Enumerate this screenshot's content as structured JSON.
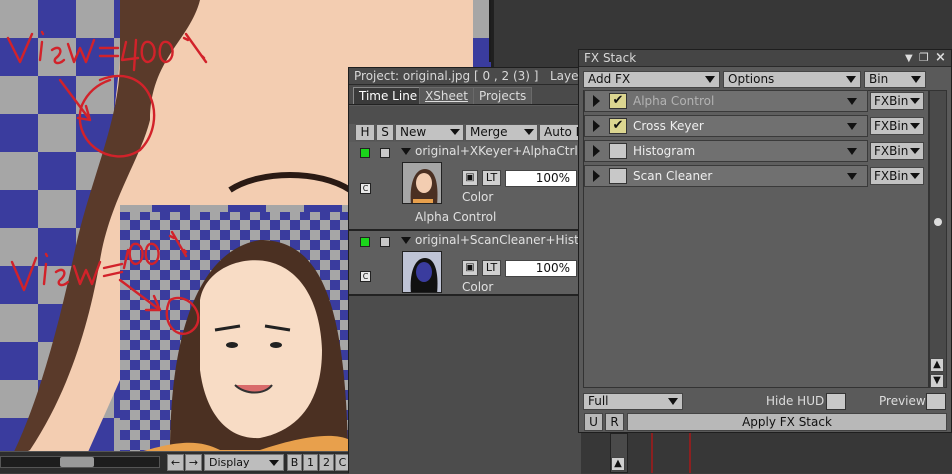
{
  "viewer": {
    "annotation_large": "view=400%",
    "annotation_small": "view=100%",
    "toolbar": {
      "display_label": "Display",
      "b_label": "B",
      "one_label": "1",
      "two_label": "2",
      "c_label": "C"
    }
  },
  "timeline": {
    "title": "Project: original.jpg [ 0 , 2  (3) ]",
    "title_suffix": "Layer:",
    "tabs": [
      "Time Line",
      "XSheet",
      "Projects"
    ],
    "columns": {
      "h": "H",
      "s": "S",
      "new": "New",
      "merge": "Merge",
      "auto": "Auto F"
    },
    "layers": [
      {
        "name": "original+XKeyer+AlphaCtrl",
        "opacity": "100%",
        "lock_label": "ὑ2",
        "lt_label": "LT",
        "mode": "Color",
        "fx_label": "Alpha Control",
        "badge": "C"
      },
      {
        "name": "original+ScanCleaner+Histo",
        "opacity": "100%",
        "lt_label": "LT",
        "mode": "Color",
        "badge": "C"
      }
    ]
  },
  "fx_stack": {
    "title": "FX Stack",
    "add_fx": "Add FX",
    "options": "Options",
    "bin": "Bin",
    "items": [
      {
        "name": "Alpha Control",
        "checked": true,
        "bin": "FXBin"
      },
      {
        "name": "Cross Keyer",
        "checked": true,
        "bin": "FXBin"
      },
      {
        "name": "Histogram",
        "checked": false,
        "bin": "FXBin"
      },
      {
        "name": "Scan Cleaner",
        "checked": false,
        "bin": "FXBin"
      }
    ],
    "quality": "Full",
    "hide_hud": "Hide HUD",
    "preview": "Preview",
    "u_label": "U",
    "r_label": "R",
    "apply_label": "Apply FX Stack"
  },
  "colors": {
    "accent_green": "#1bd51b",
    "annotation_red": "#d2222a",
    "checker_blue": "#3a3c9e"
  }
}
